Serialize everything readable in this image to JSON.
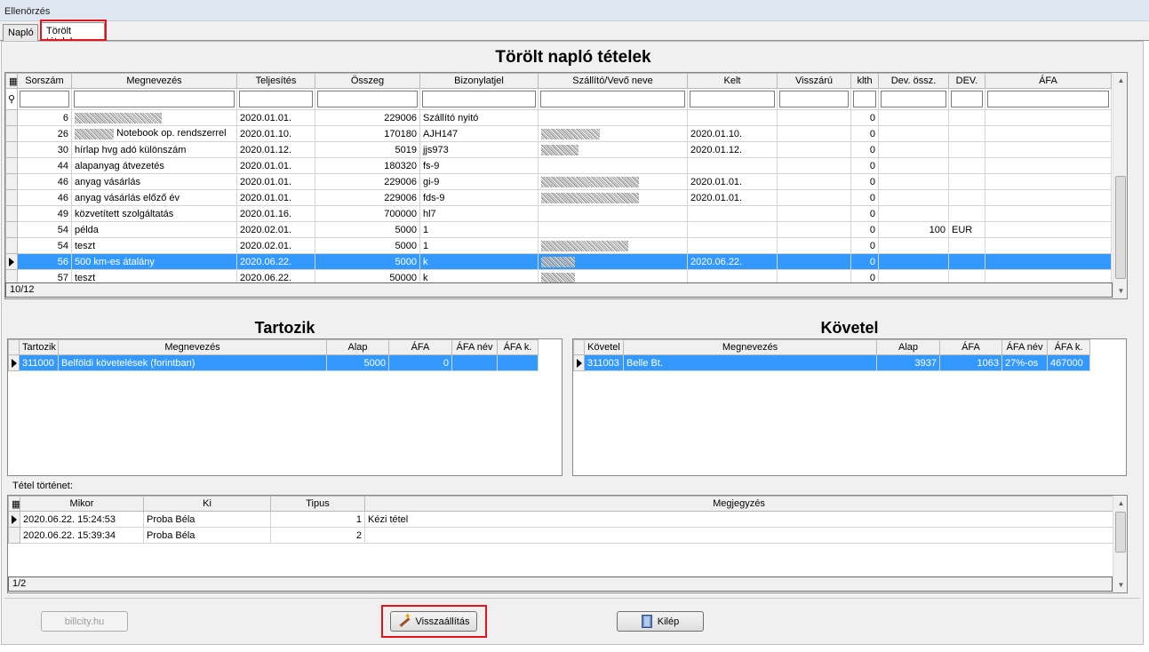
{
  "window": {
    "title": "Ellenörzés"
  },
  "tabs": [
    {
      "label": "Napló"
    },
    {
      "label": "Törölt tételek"
    }
  ],
  "main_title": "Törölt napló tételek",
  "deleted_items": {
    "columns": [
      "Sorszám",
      "Megnevezés",
      "Teljesítés",
      "Összeg",
      "Bizonylatjel",
      "Szállító/Vevő neve",
      "Kelt",
      "Visszárú",
      "klth",
      "Dev. össz.",
      "DEV.",
      "ÁFA"
    ],
    "rows": [
      {
        "sorszam": "6",
        "megnevezes": "",
        "teljesites": "2020.01.01.",
        "osszeg": "229006",
        "bizonylatjel": "Szállító nyitó",
        "partner": "",
        "kelt": "",
        "visszaru": "",
        "klth": "0",
        "dev_ossz": "",
        "dev": "",
        "afa": ""
      },
      {
        "sorszam": "26",
        "megnevezes": "Notebook op. rendszerrel",
        "teljesites": "2020.01.10.",
        "osszeg": "170180",
        "bizonylatjel": "AJH147",
        "partner": "",
        "kelt": "2020.01.10.",
        "visszaru": "",
        "klth": "0",
        "dev_ossz": "",
        "dev": "",
        "afa": ""
      },
      {
        "sorszam": "30",
        "megnevezes": "hírlap hvg adó különszám",
        "teljesites": "2020.01.12.",
        "osszeg": "5019",
        "bizonylatjel": "jjs973",
        "partner": "",
        "kelt": "2020.01.12.",
        "visszaru": "",
        "klth": "0",
        "dev_ossz": "",
        "dev": "",
        "afa": ""
      },
      {
        "sorszam": "44",
        "megnevezes": "alapanyag átvezetés",
        "teljesites": "2020.01.01.",
        "osszeg": "180320",
        "bizonylatjel": "fs-9",
        "partner": "",
        "kelt": "",
        "visszaru": "",
        "klth": "0",
        "dev_ossz": "",
        "dev": "",
        "afa": ""
      },
      {
        "sorszam": "46",
        "megnevezes": "anyag vásárlás",
        "teljesites": "2020.01.01.",
        "osszeg": "229006",
        "bizonylatjel": "gi-9",
        "partner": "",
        "kelt": "2020.01.01.",
        "visszaru": "",
        "klth": "0",
        "dev_ossz": "",
        "dev": "",
        "afa": ""
      },
      {
        "sorszam": "46",
        "megnevezes": "anyag vásárlás előző év",
        "teljesites": "2020.01.01.",
        "osszeg": "229006",
        "bizonylatjel": "fds-9",
        "partner": "",
        "kelt": "2020.01.01.",
        "visszaru": "",
        "klth": "0",
        "dev_ossz": "",
        "dev": "",
        "afa": ""
      },
      {
        "sorszam": "49",
        "megnevezes": "közvetített szolgáltatás",
        "teljesites": "2020.01.16.",
        "osszeg": "700000",
        "bizonylatjel": "hl7",
        "partner": "",
        "kelt": "",
        "visszaru": "",
        "klth": "0",
        "dev_ossz": "",
        "dev": "",
        "afa": ""
      },
      {
        "sorszam": "54",
        "megnevezes": "példa",
        "teljesites": "2020.02.01.",
        "osszeg": "5000",
        "bizonylatjel": "1",
        "partner": "",
        "kelt": "",
        "visszaru": "",
        "klth": "0",
        "dev_ossz": "100",
        "dev": "EUR",
        "afa": ""
      },
      {
        "sorszam": "54",
        "megnevezes": "teszt",
        "teljesites": "2020.02.01.",
        "osszeg": "5000",
        "bizonylatjel": "1",
        "partner": "",
        "kelt": "",
        "visszaru": "",
        "klth": "0",
        "dev_ossz": "",
        "dev": "",
        "afa": ""
      },
      {
        "sorszam": "56",
        "megnevezes": "500 km-es átalány",
        "teljesites": "2020.06.22.",
        "osszeg": "5000",
        "bizonylatjel": "k",
        "partner": "",
        "kelt": "2020.06.22.",
        "visszaru": "",
        "klth": "0",
        "dev_ossz": "",
        "dev": "",
        "afa": ""
      },
      {
        "sorszam": "57",
        "megnevezes": "teszt",
        "teljesites": "2020.06.22.",
        "osszeg": "50000",
        "bizonylatjel": "k",
        "partner": "",
        "kelt": "",
        "visszaru": "",
        "klth": "0",
        "dev_ossz": "",
        "dev": "",
        "afa": ""
      }
    ],
    "selected_index": 9,
    "nav_text": "10/12"
  },
  "debit": {
    "title": "Tartozik",
    "columns": [
      "Tartozik",
      "Megnevezés",
      "Alap",
      "ÁFA",
      "ÁFA név",
      "ÁFA k."
    ],
    "rows": [
      {
        "account": "311000",
        "name": "Belföldi követelések (forintban)",
        "alap": "5000",
        "afa": "0",
        "afa_nev": "",
        "afa_k": ""
      }
    ]
  },
  "credit": {
    "title": "Követel",
    "columns": [
      "Követel",
      "Megnevezés",
      "Alap",
      "ÁFA",
      "ÁFA név",
      "ÁFA k."
    ],
    "rows": [
      {
        "account": "311003",
        "name": "Belle Bt.",
        "alap": "3937",
        "afa": "1063",
        "afa_nev": "27%-os",
        "afa_k": "467000"
      }
    ]
  },
  "history": {
    "label": "Tétel történet:",
    "columns": [
      "Mikor",
      "Ki",
      "Tipus",
      "Megjegyzés"
    ],
    "rows": [
      {
        "mikor": "2020.06.22. 15:24:53",
        "ki": "Proba Béla",
        "tipus": "1",
        "megjegyzes": "Kézi tétel"
      },
      {
        "mikor": "2020.06.22. 15:39:34",
        "ki": "Proba Béla",
        "tipus": "2",
        "megjegyzes": ""
      }
    ],
    "nav_text": "1/2"
  },
  "buttons": {
    "billcity": "billcity.hu",
    "restore": "Visszaállítás",
    "exit": "Kilép"
  },
  "icons": {
    "restore": "magic-wand-icon",
    "exit": "exit-door-icon"
  },
  "colors": {
    "selection": "#3399ff",
    "highlight_box": "#e0161c"
  }
}
